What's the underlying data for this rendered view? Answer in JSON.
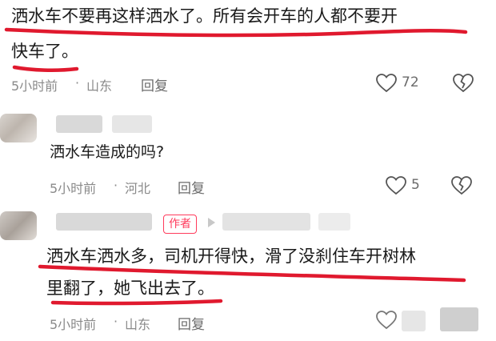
{
  "comment1": {
    "text_line1": "洒水车不要再这样洒水了。所有会开车的人都不要开",
    "text_line2": "快车了。",
    "time": "5小时前",
    "location": "山东",
    "reply_label": "回复",
    "likes": "72"
  },
  "comment2": {
    "text": "洒水车造成的吗?",
    "time": "5小时前",
    "location": "河北",
    "reply_label": "回复",
    "likes": "5"
  },
  "comment3": {
    "author_tag": "作者",
    "text_line1": "洒水车洒水多，司机开得快，滑了没刹住车开树林",
    "text_line2": "里翻了，她飞出去了。",
    "time": "5小时前",
    "location": "山东",
    "reply_label": "回复"
  },
  "colors": {
    "underline": "#e0192e",
    "author_tag": "#ff3b5c"
  },
  "icons": [
    "heart-icon",
    "heart-broken-icon",
    "triangle-icon"
  ]
}
